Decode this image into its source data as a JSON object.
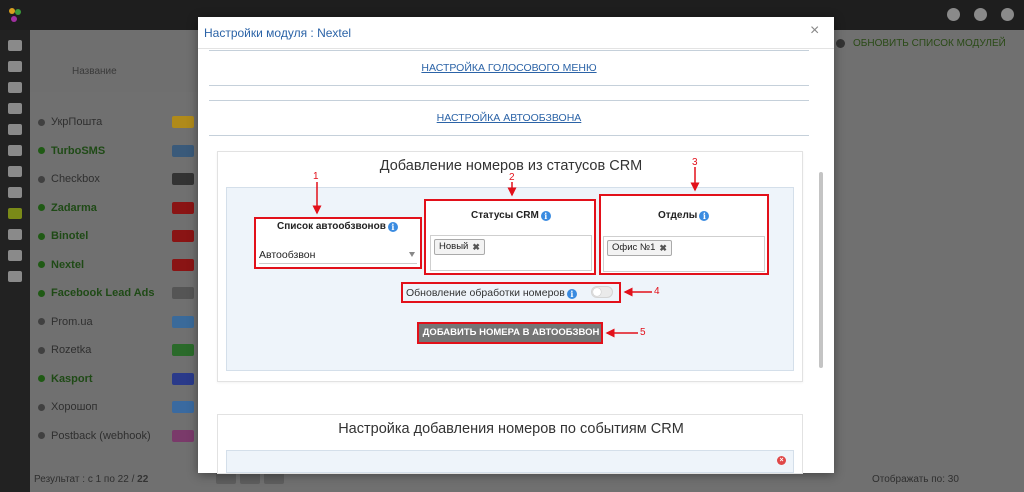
{
  "background": {
    "column_header": "Название",
    "list_items": [
      {
        "label": "УкрПошта",
        "enabled": false
      },
      {
        "label": "TurboSMS",
        "enabled": true
      },
      {
        "label": "Checkbox",
        "enabled": false
      },
      {
        "label": "Zadarma",
        "enabled": true
      },
      {
        "label": "Binotel",
        "enabled": true
      },
      {
        "label": "Nextel",
        "enabled": true
      },
      {
        "label": "Facebook Lead Ads",
        "enabled": true
      },
      {
        "label": "Prom.ua",
        "enabled": false
      },
      {
        "label": "Rozetka",
        "enabled": false
      },
      {
        "label": "Kasport",
        "enabled": true
      },
      {
        "label": "Хорошоп",
        "enabled": false
      },
      {
        "label": "Postback (webhook)",
        "enabled": false
      }
    ],
    "refresh_label": "ОБНОВИТЬ СПИСОК МОДУЛЕЙ",
    "footer_results": "Результат : с 1 по 22 /",
    "footer_total": "22",
    "footer_perpage": "Отображать по: 30"
  },
  "modal": {
    "title": "Настройки модуля : Nextel",
    "close_glyph": "×",
    "link_voice_menu": "НАСТРОЙКА ГОЛОСОВОГО МЕНЮ",
    "link_autodial": "НАСТРОЙКА АВТООБЗВОНА",
    "section1_title": "Добавление номеров из статусов CRM",
    "autodial_list_label": "Список автообзвонов",
    "autodial_list_value": "Автообзвон",
    "crm_status_label": "Статусы CRM",
    "crm_status_tag": "Новый",
    "departments_label": "Отделы",
    "departments_tag": "Офис №1",
    "update_processing_label": "Обновление обработки номеров",
    "update_processing_on": false,
    "add_button_label": "ДОБАВИТЬ НОМЕРА В АВТООБЗВОН",
    "section2_title": "Настройка добавления номеров по событиям CRM",
    "tag_remove_glyph": "✖",
    "info_glyph": "i",
    "delete_glyph": "×"
  },
  "annotations": [
    "1",
    "2",
    "3",
    "4",
    "5"
  ],
  "colors": {
    "annotation_red": "#e2101a",
    "link_blue": "#2b63a7",
    "button_gray": "#757575",
    "enabled_green": "#1f5a14"
  }
}
